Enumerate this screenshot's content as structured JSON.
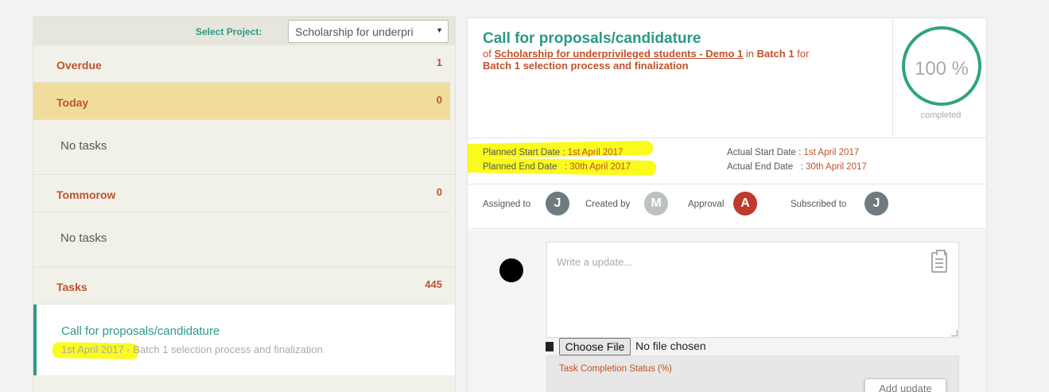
{
  "project": {
    "label": "Select Project:",
    "selected": "Scholarship for underpri"
  },
  "sections": {
    "overdue": {
      "name": "Overdue",
      "count": "1"
    },
    "today": {
      "name": "Today",
      "count": "0"
    },
    "today_empty": "No tasks",
    "tomorrow": {
      "name": "Tommorow",
      "count": "0"
    },
    "tomorrow_empty": "No tasks",
    "tasks": {
      "name": "Tasks",
      "count": "445"
    }
  },
  "task_card": {
    "title": "Call for proposals/candidature",
    "date": "1st April 2017",
    "rest": " - Batch 1 selection process and finalization"
  },
  "detail": {
    "title": "Call for proposals/candidature",
    "of": "of ",
    "project_link": "Scholarship for underprivileged students - Demo 1",
    "in": " in ",
    "batch": "Batch 1",
    "for": " for",
    "stage": "Batch 1 selection process and finalization",
    "progress_value": "100 %",
    "progress_label": "completed",
    "progress_fraction": 1.0
  },
  "dates": {
    "planned_start_label": "Planned Start Date : ",
    "planned_start": "1st April 2017",
    "planned_end_label": "Planned End Date   : ",
    "planned_end": "30th April 2017",
    "actual_start_label": "Actual Start Date : ",
    "actual_start": "1st April 2017",
    "actual_end_label": "Actual End Date   : ",
    "actual_end": "30th April 2017"
  },
  "people": {
    "assigned_label": "Assigned to",
    "assigned_initial": "J",
    "created_label": "Created by",
    "created_initial": "M",
    "approval_label": "Approval",
    "approval_initial": "A",
    "subscribed_label": "Subscribed to",
    "subscribed_initial": "J"
  },
  "update": {
    "placeholder": "Write a update...",
    "choose_file": "Choose File",
    "no_file": "No file chosen",
    "status_label": "Task Completion Status (%)",
    "add_button": "Add update"
  },
  "colors": {
    "teal": "#2a9a86",
    "orange": "#c0522a",
    "highlight": "#fafa1e",
    "today_bg": "#f0dd9e",
    "approval_red": "#c0392b",
    "avatar_grey": "#6e7b7f"
  }
}
